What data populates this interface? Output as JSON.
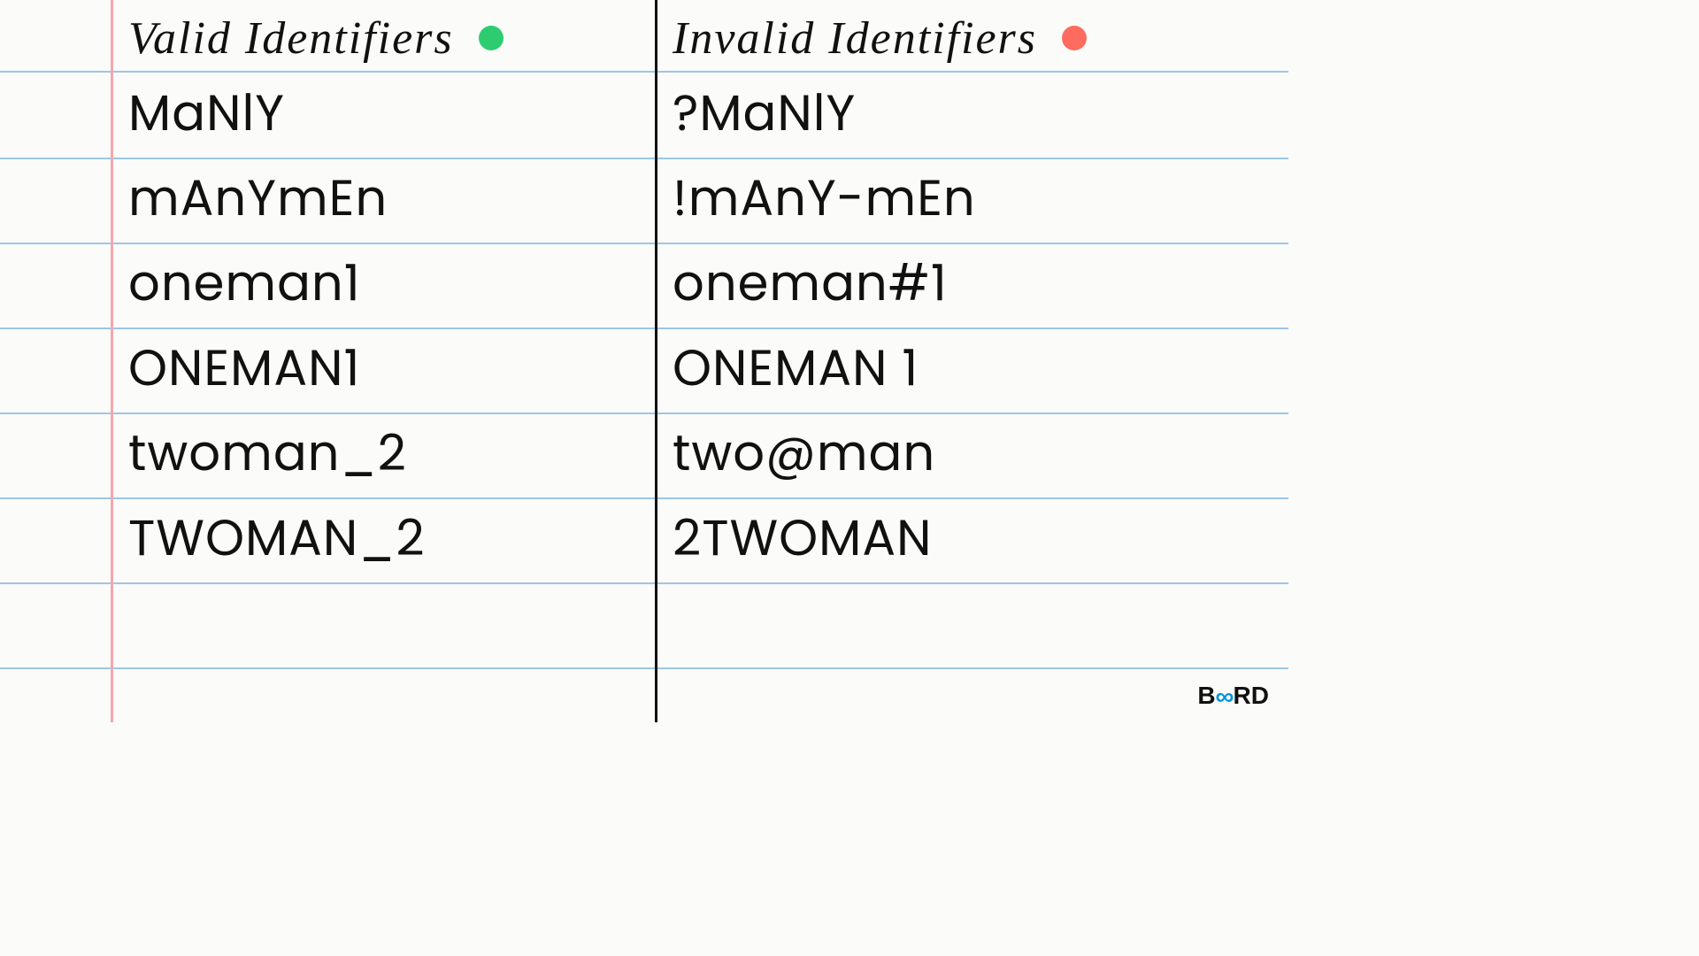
{
  "columns": {
    "valid": {
      "title": "Valid Identifiers",
      "dot_color": "green",
      "items": [
        "MaNlY",
        "mAnYmEn",
        "oneman1",
        "ONEMAN1",
        "twoman_2",
        "TWOMAN_2"
      ]
    },
    "invalid": {
      "title": "Invalid Identifiers",
      "dot_color": "red",
      "items": [
        "?MaNlY",
        "!mAnY-mEn",
        "oneman#1",
        "ONEMAN 1",
        "two@man",
        "2TWOMAN"
      ]
    }
  },
  "logo": {
    "text_left": "B",
    "text_mid": "∞",
    "text_right": "RD"
  },
  "colors": {
    "rule": "#9cc6e9",
    "margin": "#f5a6ae",
    "green": "#2ecc71",
    "red": "#ff6b5e"
  }
}
